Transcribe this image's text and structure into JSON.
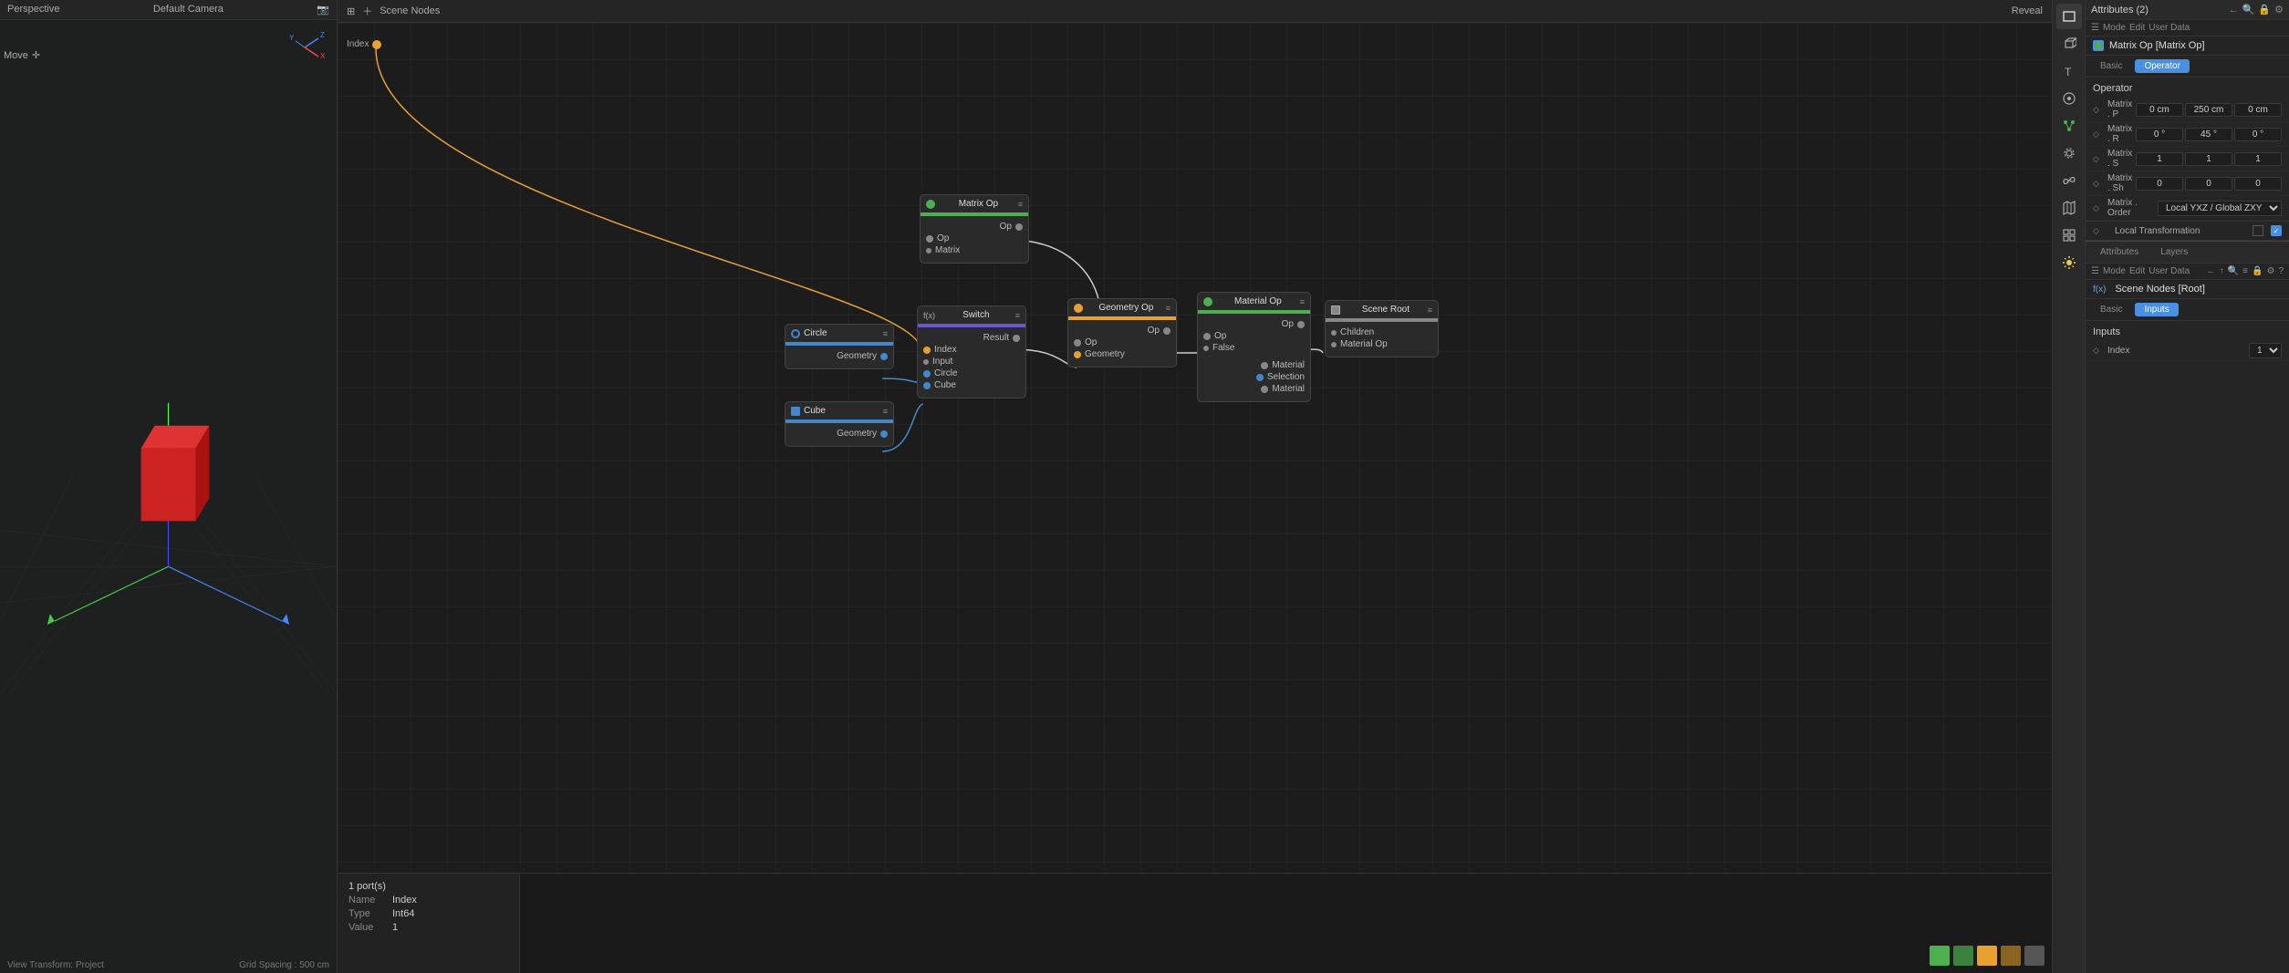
{
  "viewport": {
    "mode": "Perspective",
    "camera": "Default Camera",
    "move_label": "Move",
    "grid_spacing": "Grid Spacing : 500 cm",
    "view_transform": "View Transform: Project"
  },
  "node_editor": {
    "title": "Scene Nodes",
    "reveal_btn": "Reveal",
    "index_node": "Index",
    "nodes": {
      "circle": {
        "name": "Circle",
        "bar_color": "#4488cc",
        "port": "Geometry"
      },
      "cube": {
        "name": "Cube",
        "bar_color": "#4488cc",
        "port": "Geometry"
      },
      "switch": {
        "name": "Switch",
        "prefix": "f(x)",
        "bar_color": "#6a5acd",
        "ports_in": [
          "Index",
          "Input",
          "Circle",
          "Cube"
        ],
        "port_out": "Result"
      },
      "matrix_op": {
        "name": "Matrix Op",
        "bar_color": "#4caf50",
        "ports_in": [
          "Op",
          "Matrix"
        ],
        "port_out": "Op"
      },
      "geometry_op": {
        "name": "Geometry Op",
        "bar_color": "#e8a030",
        "ports_in": [
          "Op",
          "Geometry"
        ],
        "port_out": "Op"
      },
      "material_op": {
        "name": "Material Op",
        "bar_color": "#4caf50",
        "ports_in": [
          "Op",
          "False"
        ],
        "ports_out_labels": [
          "Op",
          "Material",
          "Selection",
          "Material"
        ]
      },
      "scene_root": {
        "name": "Scene Root",
        "bar_color": "#888",
        "ports_in": [
          "Children",
          "Material Op"
        ]
      }
    }
  },
  "info_panel": {
    "port_count": "1 port(s)",
    "name_label": "Name",
    "name_val": "Index",
    "type_label": "Type",
    "type_val": "Int64",
    "value_label": "Value",
    "value_val": "1"
  },
  "attrs_top": {
    "title": "Attributes (2)",
    "mode": "Mode",
    "edit": "Edit",
    "user_data": "User Data",
    "node_name": "Matrix Op [Matrix Op]",
    "tabs": [
      "Basic",
      "Operator"
    ],
    "active_tab": "Operator",
    "section": "Operator",
    "props": [
      {
        "icon": "◇",
        "label": "Matrix . P",
        "vals": [
          "0 cm",
          "250 cm",
          "0 cm"
        ]
      },
      {
        "icon": "◇",
        "label": "Matrix . R",
        "vals": [
          "0 °",
          "45 °",
          "0 °"
        ]
      },
      {
        "icon": "◇",
        "label": "Matrix . S",
        "vals": [
          "1",
          "1",
          "1"
        ]
      },
      {
        "icon": "◇",
        "label": "Matrix . Sh",
        "vals": [
          "0",
          "0",
          "0"
        ]
      },
      {
        "icon": "◇",
        "label": "Matrix . Order",
        "val_wide": "Local YXZ / Global ZXY"
      }
    ],
    "local_transform": "Local Transformation"
  },
  "attrs_bottom": {
    "tab1": "Attributes",
    "tab2": "Layers",
    "mode": "Mode",
    "edit": "Edit",
    "user_data": "User Data",
    "node_name": "Scene Nodes [Root]",
    "tabs": [
      "Basic",
      "Inputs"
    ],
    "active_tab": "Inputs",
    "section": "Inputs",
    "inputs_label": "Inputs",
    "index_label": "Index",
    "index_val": "1"
  },
  "toolbar": {
    "icons": [
      "▭",
      "▬",
      "T",
      "⊙",
      "✿",
      "⚙",
      "🔗",
      "🗺",
      "⊞",
      "☀"
    ]
  },
  "colors": {
    "accent_blue": "#4a90e2",
    "accent_green": "#4caf50",
    "accent_orange": "#e8a030",
    "accent_purple": "#6a5acd",
    "node_bg": "#2a2a2a"
  }
}
